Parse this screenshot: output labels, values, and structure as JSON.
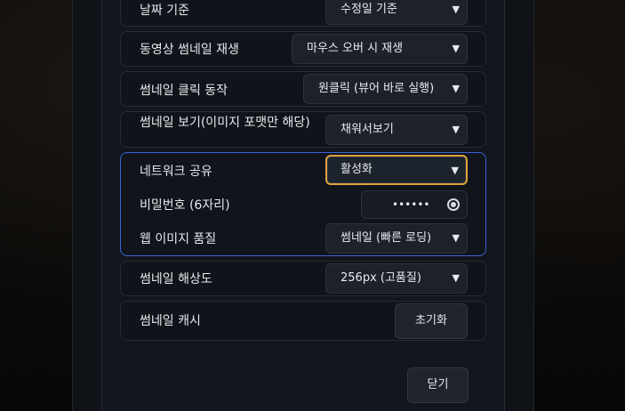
{
  "settings": {
    "date_basis": {
      "label": "날짜 기준",
      "value": "수정일 기준"
    },
    "video_thumb_play": {
      "label": "동영상 썸네일 재생",
      "value": "마우스 오버 시 재생"
    },
    "thumb_click_action": {
      "label": "썸네일 클릭 동작",
      "value": "원클릭 (뷰어 바로 실행)"
    },
    "thumb_view_mode": {
      "label": "썸네일 보기(이미지 포맷만 해당)",
      "value": "채워서보기"
    },
    "network_share": {
      "label": "네트워크 공유",
      "value": "활성화",
      "password_label": "비밀번호 (6자리)",
      "password_value": "••••••",
      "web_quality_label": "웹 이미지 품질",
      "web_quality_value": "썸네일 (빠른 로딩)"
    },
    "thumb_resolution": {
      "label": "썸네일 해상도",
      "value": "256px (고품질)"
    },
    "thumb_cache": {
      "label": "썸네일 캐시",
      "button": "초기화"
    }
  },
  "footer": {
    "close_label": "닫기"
  },
  "icons": {
    "select_chevron": "chevron-down-icon",
    "password_toggle": "eye-icon"
  },
  "colors": {
    "focus_ring": "#e0a23a",
    "group_border": "#3d63d6",
    "panel_bg": "#12161d"
  }
}
